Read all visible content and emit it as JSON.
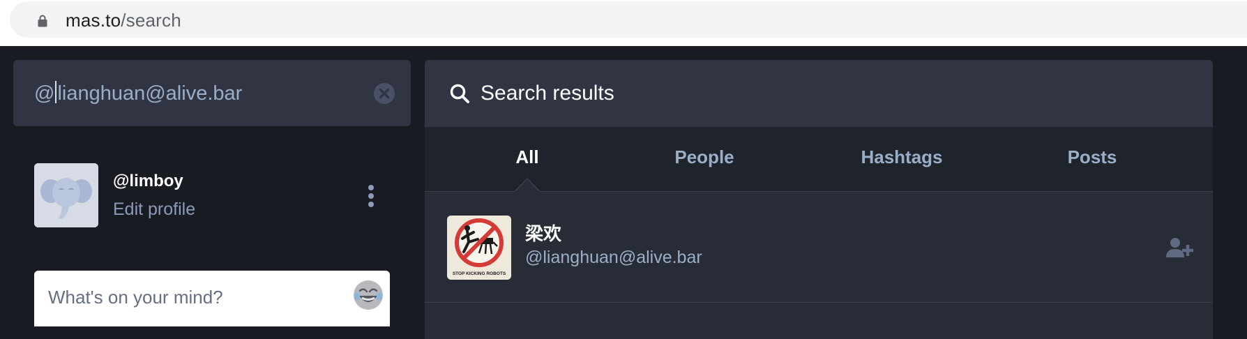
{
  "browser": {
    "url_host": "mas.to",
    "url_path": "/search",
    "lock_icon": "lock-icon"
  },
  "search": {
    "value_prefix": "@",
    "value_rest": "lianghuan@alive.bar",
    "clear_icon": "clear-circle-icon"
  },
  "profile": {
    "handle": "@limboy",
    "edit_label": "Edit profile",
    "menu_icon": "kebab-icon"
  },
  "compose": {
    "placeholder": "What's on your mind?",
    "emoji_icon": "laughing-emoji-icon"
  },
  "results": {
    "title": "Search results",
    "tabs": [
      {
        "label": "All",
        "active": true
      },
      {
        "label": "People",
        "active": false
      },
      {
        "label": "Hashtags",
        "active": false
      },
      {
        "label": "Posts",
        "active": false
      }
    ],
    "accounts": [
      {
        "display_name": "梁欢",
        "acct": "@lianghuan@alive.bar",
        "avatar_caption": "STOP KICKING ROBOTS",
        "action_icon": "follow-user-plus-icon"
      }
    ]
  },
  "colors": {
    "page_bg": "#191b22",
    "panel": "#313543",
    "results_bg": "#282c37",
    "muted_text": "#9baec8",
    "stop_sign_red": "#d63a36"
  }
}
